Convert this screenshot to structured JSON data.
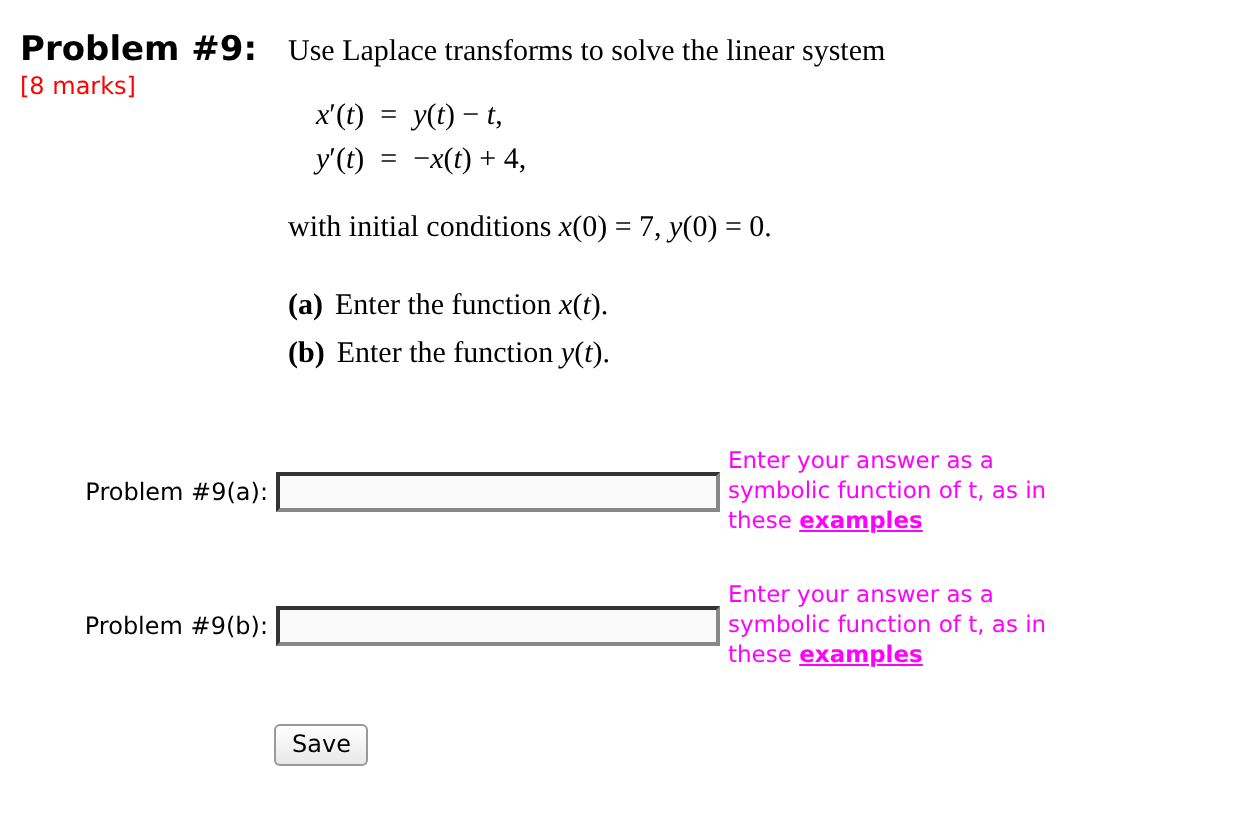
{
  "problem": {
    "title": "Problem #9:",
    "marks": "[8 marks]",
    "intro": "Use Laplace transforms to solve the linear system",
    "equations": [
      {
        "lhs": "*x*′(*t*)",
        "rel": "=",
        "rhs": "*y*(*t*) − *t*,"
      },
      {
        "lhs": "*y*′(*t*)",
        "rel": "=",
        "rhs": "−*x*(*t*) + 4,"
      }
    ],
    "conditions": "with initial conditions *x*(0) = 7, *y*(0) = 0.",
    "parts": [
      {
        "tag": "(a)",
        "text": "Enter the function *x*(*t*)."
      },
      {
        "tag": "(b)",
        "text": "Enter the function *y*(*t*)."
      }
    ]
  },
  "answers": [
    {
      "label": "Problem #9(a):",
      "hint": "Enter your answer as a symbolic function of t, as in these",
      "link": "examples"
    },
    {
      "label": "Problem #9(b):",
      "hint": "Enter your answer as a symbolic function of t, as in these",
      "link": "examples"
    }
  ],
  "save_button": "Save"
}
